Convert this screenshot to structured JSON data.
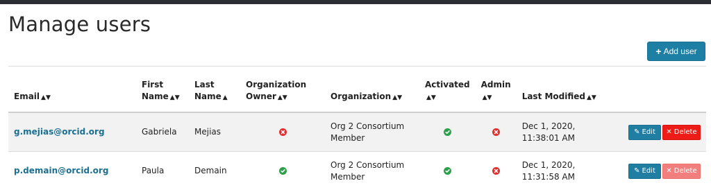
{
  "page": {
    "title": "Manage users",
    "add_user_label": "Add user"
  },
  "table": {
    "headers": {
      "email": "Email",
      "first_name_1": "First",
      "first_name_2": "Name",
      "last_name_1": "Last",
      "last_name_2": "Name",
      "org_owner_1": "Organization",
      "org_owner_2": "Owner",
      "organization": "Organization",
      "activated_1": "Activated",
      "admin_1": "Admin",
      "last_modified": "Last Modified"
    },
    "rows": [
      {
        "email": "g.mejias@orcid.org",
        "first_name": "Gabriela",
        "last_name": "Mejias",
        "org_owner": false,
        "org_line1": "Org 2 Consortium",
        "org_line2": "Member",
        "activated": true,
        "admin": false,
        "modified_line1": "Dec 1, 2020,",
        "modified_line2": "11:38:01 AM",
        "edit_label": "Edit",
        "delete_label": "Delete"
      },
      {
        "email": "p.demain@orcid.org",
        "first_name": "Paula",
        "last_name": "Demain",
        "org_owner": true,
        "org_line1": "Org 2 Consortium",
        "org_line2": "Member",
        "activated": true,
        "admin": false,
        "modified_line1": "Dec 1, 2020,",
        "modified_line2": "11:31:58 AM",
        "edit_label": "Edit",
        "delete_label": "Delete"
      }
    ]
  },
  "colors": {
    "accent": "#1d7fa3",
    "danger": "#ee1c17",
    "success": "#2e9f4b"
  }
}
